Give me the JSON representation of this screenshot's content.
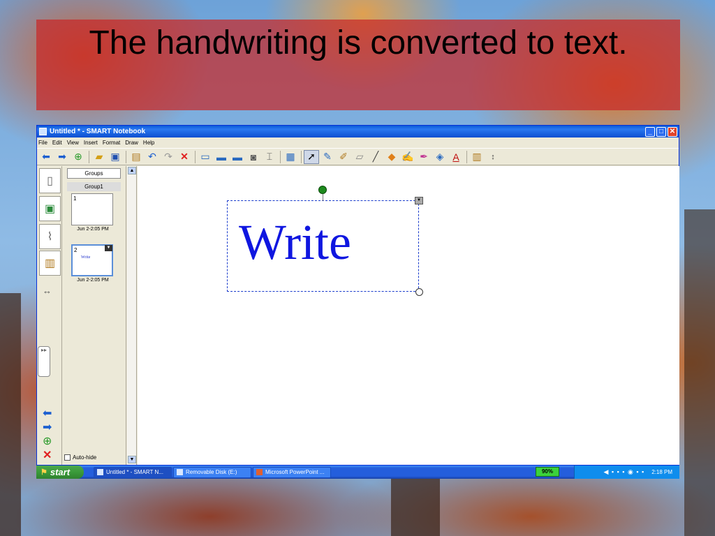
{
  "slide": {
    "title": "The handwriting is converted to text."
  },
  "window": {
    "title": "Untitled * - SMART Notebook",
    "minimize": "_",
    "restore": "□",
    "close": "✕"
  },
  "menu": [
    "File",
    "Edit",
    "View",
    "Insert",
    "Format",
    "Draw",
    "Help"
  ],
  "toolbar": {
    "icons": [
      "back-arrow-icon",
      "forward-arrow-icon",
      "add-page-icon",
      "open-folder-icon",
      "save-icon",
      "paste-icon",
      "undo-icon",
      "redo-icon",
      "delete-icon",
      "screen-shade-icon",
      "display-icon",
      "dual-display-icon",
      "screen-capture-icon",
      "table-tool-icon",
      "table-icon",
      "select-icon",
      "pen-icon",
      "creative-pen-icon",
      "eraser-icon",
      "line-icon",
      "shape-icon",
      "magic-pen-icon",
      "highlighter-icon",
      "fill-icon",
      "text-icon",
      "properties-icon",
      "move-toolbar-icon"
    ]
  },
  "sorter": {
    "groups_button": "Groups",
    "group_label": "Group1",
    "pages": [
      {
        "number": "1",
        "date": "Jun 2-2:05 PM",
        "content": ""
      },
      {
        "number": "2",
        "date": "Jun 2-2:05 PM",
        "content": "Write"
      }
    ],
    "auto_hide": "Auto-hide"
  },
  "canvas": {
    "text": "Write"
  },
  "taskbar": {
    "start": "start",
    "tasks": [
      "Untitled * - SMART N...",
      "Removable Disk (E:)",
      "Microsoft PowerPoint ..."
    ],
    "battery": "90%",
    "clock": "2:18 PM"
  }
}
